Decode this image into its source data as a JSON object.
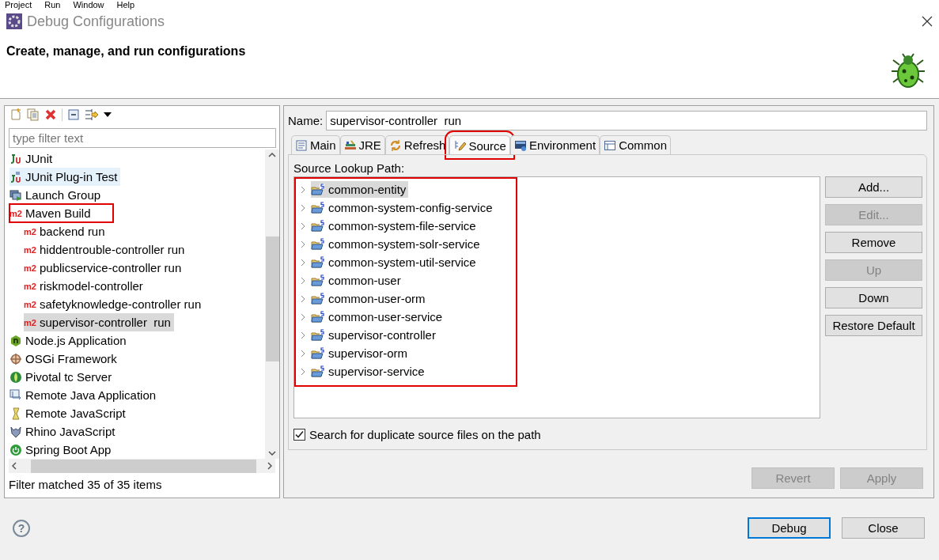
{
  "menu_bar": [
    {
      "label": "Project"
    },
    {
      "label": "Run"
    },
    {
      "label": "Window"
    },
    {
      "label": "Help"
    }
  ],
  "window": {
    "title": "Debug Configurations"
  },
  "header": {
    "title": "Create, manage, and run configurations"
  },
  "config_tree": {
    "filter": {
      "placeholder": "type filter text"
    },
    "items": [
      {
        "label": "JUnit",
        "kind": "junit",
        "selected": false,
        "hovered": false,
        "annotated": false
      },
      {
        "label": "JUnit Plug-in Test",
        "kind": "plugin-test",
        "selected": false,
        "hovered": true,
        "annotated": false
      },
      {
        "label": "Launch Group",
        "kind": "launch-group",
        "selected": false,
        "hovered": false,
        "annotated": false
      },
      {
        "label": "Maven Build",
        "kind": "maven",
        "icon_text": "m2",
        "selected": false,
        "hovered": false,
        "annotated": true,
        "children": [
          {
            "label": "backend run",
            "kind": "maven",
            "icon_text": "m2",
            "selected": false,
            "hovered": false,
            "annotated": false
          },
          {
            "label": "hiddentrouble-controller run",
            "kind": "maven",
            "icon_text": "m2",
            "selected": false,
            "hovered": false,
            "annotated": false
          },
          {
            "label": "publicservice-controller run",
            "kind": "maven",
            "icon_text": "m2",
            "selected": false,
            "hovered": false,
            "annotated": false
          },
          {
            "label": "riskmodel-controller",
            "kind": "maven",
            "icon_text": "m2",
            "selected": false,
            "hovered": false,
            "annotated": false
          },
          {
            "label": "safetyknowledge-controller run",
            "kind": "maven",
            "icon_text": "m2",
            "selected": false,
            "hovered": false,
            "annotated": false
          },
          {
            "label": "supervisor-controller  run",
            "kind": "maven",
            "icon_text": "m2",
            "selected": true,
            "hovered": false,
            "annotated": false
          }
        ]
      },
      {
        "label": "Node.js Application",
        "kind": "node",
        "selected": false,
        "hovered": false,
        "annotated": false
      },
      {
        "label": "OSGi Framework",
        "kind": "osgi",
        "selected": false,
        "hovered": false,
        "annotated": false
      },
      {
        "label": "Pivotal tc Server",
        "kind": "pivotal",
        "selected": false,
        "hovered": false,
        "annotated": false
      },
      {
        "label": "Remote Java Application",
        "kind": "remote-java",
        "selected": false,
        "hovered": false,
        "annotated": false
      },
      {
        "label": "Remote JavaScript",
        "kind": "remote-js",
        "selected": false,
        "hovered": false,
        "annotated": false
      },
      {
        "label": "Rhino JavaScript",
        "kind": "rhino",
        "selected": false,
        "hovered": false,
        "annotated": false
      },
      {
        "label": "Spring Boot App",
        "kind": "spring",
        "selected": false,
        "hovered": false,
        "annotated": false
      }
    ],
    "status": "Filter matched 35 of 35 items"
  },
  "name_field": {
    "label": "Name:",
    "value": "supervisor-controller  run"
  },
  "tabs": [
    {
      "label": "Main",
      "kind": "main",
      "selected": false,
      "annotated": false
    },
    {
      "label": "JRE",
      "kind": "jre",
      "selected": false,
      "annotated": false
    },
    {
      "label": "Refresh",
      "kind": "refresh",
      "selected": false,
      "annotated": false
    },
    {
      "label": "Source",
      "kind": "source",
      "selected": true,
      "annotated": true
    },
    {
      "label": "Environment",
      "kind": "environment",
      "selected": false,
      "annotated": false
    },
    {
      "label": "Common",
      "kind": "common",
      "selected": false,
      "annotated": false
    }
  ],
  "source_tab": {
    "label": "Source Lookup Path:",
    "annotated": true,
    "entries": [
      {
        "label": "common-entity",
        "selected": true,
        "expanded": false
      },
      {
        "label": "common-system-config-service",
        "selected": false,
        "expanded": false
      },
      {
        "label": "common-system-file-service",
        "selected": false,
        "expanded": false
      },
      {
        "label": "common-system-solr-service",
        "selected": false,
        "expanded": false
      },
      {
        "label": "common-system-util-service",
        "selected": false,
        "expanded": false
      },
      {
        "label": "common-user",
        "selected": false,
        "expanded": false
      },
      {
        "label": "common-user-orm",
        "selected": false,
        "expanded": false
      },
      {
        "label": "common-user-service",
        "selected": false,
        "expanded": false
      },
      {
        "label": "supervisor-controller",
        "selected": false,
        "expanded": false
      },
      {
        "label": "supervisor-orm",
        "selected": false,
        "expanded": false
      },
      {
        "label": "supervisor-service",
        "selected": false,
        "expanded": false
      }
    ],
    "buttons": [
      {
        "label": "Add...",
        "disabled": false
      },
      {
        "label": "Edit...",
        "disabled": true
      },
      {
        "label": "Remove",
        "disabled": false
      },
      {
        "label": "Up",
        "disabled": true
      },
      {
        "label": "Down",
        "disabled": false
      },
      {
        "label": "Restore Default",
        "disabled": false
      }
    ],
    "duplicate_check": {
      "label": "Search for duplicate source files on the path",
      "checked": true
    }
  },
  "panel_buttons": [
    {
      "label": "Revert",
      "disabled": true
    },
    {
      "label": "Apply",
      "disabled": true
    }
  ],
  "help": {
    "glyph": "?"
  },
  "dialog_buttons": [
    {
      "label": "Debug",
      "default": true
    },
    {
      "label": "Close",
      "default": false
    }
  ]
}
